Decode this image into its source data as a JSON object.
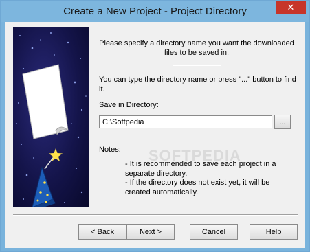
{
  "window": {
    "title": "Create a New Project - Project Directory",
    "close_glyph": "✕"
  },
  "content": {
    "intro": "Please specify a directory name you want the downloaded files to be saved in.",
    "hint": "You can type the directory name or press \"...\" button to find it.",
    "save_label": "Save in Directory:",
    "directory_value": "C:\\Softpedia",
    "browse_label": "...",
    "notes_label": "Notes:",
    "note1": "- It is recommended to save each project in a separate directory.",
    "note2": "- If the directory does not exist yet, it will be created automatically."
  },
  "buttons": {
    "back": "< Back",
    "next": "Next >",
    "cancel": "Cancel",
    "help": "Help"
  },
  "watermark": "SOFTPEDIA",
  "colors": {
    "titlebar": "#7db6de",
    "close": "#c7352a",
    "dialog_bg": "#f0f0f0"
  },
  "icons": {
    "close": "close-icon",
    "side_art": "wizard-hat-document-illustration"
  }
}
